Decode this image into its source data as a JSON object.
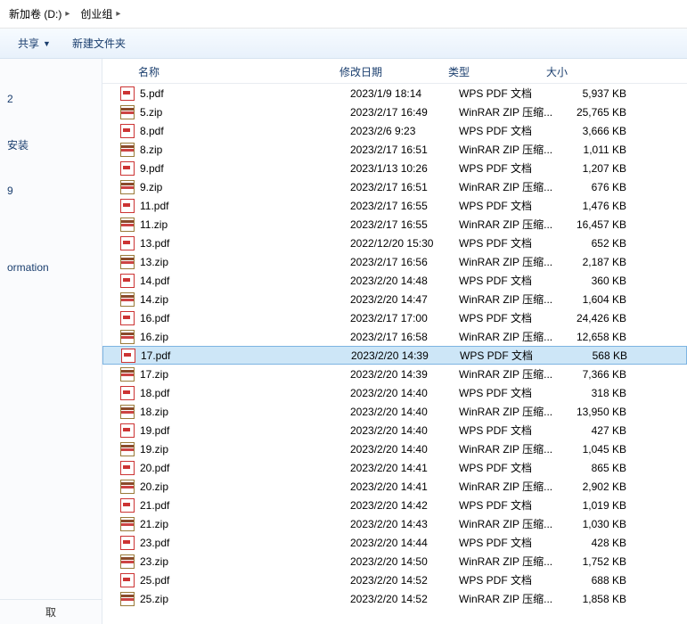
{
  "address": {
    "segments": [
      {
        "label": "新加卷 (D:)"
      },
      {
        "label": "创业组"
      }
    ]
  },
  "toolbar": {
    "share_label": "共享",
    "newfolder_label": "新建文件夹"
  },
  "navpane": {
    "items": [
      {
        "label": ""
      },
      {
        "label": ""
      },
      {
        "label": "2"
      },
      {
        "label": ""
      },
      {
        "label": ""
      },
      {
        "label": "安装"
      },
      {
        "label": ""
      },
      {
        "label": ""
      },
      {
        "label": "9"
      },
      {
        "label": ""
      },
      {
        "label": ""
      },
      {
        "label": ""
      },
      {
        "label": ""
      },
      {
        "label": ""
      },
      {
        "label": "ormation"
      },
      {
        "label": ""
      },
      {
        "label": ""
      },
      {
        "label": ""
      },
      {
        "label": ""
      }
    ],
    "bottom_label": "取"
  },
  "columns": {
    "name": "名称",
    "date": "修改日期",
    "type": "类型",
    "size": "大小"
  },
  "files": [
    {
      "name": "5.pdf",
      "icon": "pdf",
      "date": "2023/1/9 18:14",
      "type": "WPS PDF 文档",
      "size": "5,937 KB",
      "selected": false
    },
    {
      "name": "5.zip",
      "icon": "zip",
      "date": "2023/2/17 16:49",
      "type": "WinRAR ZIP 压缩...",
      "size": "25,765 KB",
      "selected": false
    },
    {
      "name": "8.pdf",
      "icon": "pdf",
      "date": "2023/2/6 9:23",
      "type": "WPS PDF 文档",
      "size": "3,666 KB",
      "selected": false
    },
    {
      "name": "8.zip",
      "icon": "zip",
      "date": "2023/2/17 16:51",
      "type": "WinRAR ZIP 压缩...",
      "size": "1,011 KB",
      "selected": false
    },
    {
      "name": "9.pdf",
      "icon": "pdf",
      "date": "2023/1/13 10:26",
      "type": "WPS PDF 文档",
      "size": "1,207 KB",
      "selected": false
    },
    {
      "name": "9.zip",
      "icon": "zip",
      "date": "2023/2/17 16:51",
      "type": "WinRAR ZIP 压缩...",
      "size": "676 KB",
      "selected": false
    },
    {
      "name": "11.pdf",
      "icon": "pdf",
      "date": "2023/2/17 16:55",
      "type": "WPS PDF 文档",
      "size": "1,476 KB",
      "selected": false
    },
    {
      "name": "11.zip",
      "icon": "zip",
      "date": "2023/2/17 16:55",
      "type": "WinRAR ZIP 压缩...",
      "size": "16,457 KB",
      "selected": false
    },
    {
      "name": "13.pdf",
      "icon": "pdf",
      "date": "2022/12/20 15:30",
      "type": "WPS PDF 文档",
      "size": "652 KB",
      "selected": false
    },
    {
      "name": "13.zip",
      "icon": "zip",
      "date": "2023/2/17 16:56",
      "type": "WinRAR ZIP 压缩...",
      "size": "2,187 KB",
      "selected": false
    },
    {
      "name": "14.pdf",
      "icon": "pdf",
      "date": "2023/2/20 14:48",
      "type": "WPS PDF 文档",
      "size": "360 KB",
      "selected": false
    },
    {
      "name": "14.zip",
      "icon": "zip",
      "date": "2023/2/20 14:47",
      "type": "WinRAR ZIP 压缩...",
      "size": "1,604 KB",
      "selected": false
    },
    {
      "name": "16.pdf",
      "icon": "pdf",
      "date": "2023/2/17 17:00",
      "type": "WPS PDF 文档",
      "size": "24,426 KB",
      "selected": false
    },
    {
      "name": "16.zip",
      "icon": "zip",
      "date": "2023/2/17 16:58",
      "type": "WinRAR ZIP 压缩...",
      "size": "12,658 KB",
      "selected": false
    },
    {
      "name": "17.pdf",
      "icon": "pdf",
      "date": "2023/2/20 14:39",
      "type": "WPS PDF 文档",
      "size": "568 KB",
      "selected": true
    },
    {
      "name": "17.zip",
      "icon": "zip",
      "date": "2023/2/20 14:39",
      "type": "WinRAR ZIP 压缩...",
      "size": "7,366 KB",
      "selected": false
    },
    {
      "name": "18.pdf",
      "icon": "pdf",
      "date": "2023/2/20 14:40",
      "type": "WPS PDF 文档",
      "size": "318 KB",
      "selected": false
    },
    {
      "name": "18.zip",
      "icon": "zip",
      "date": "2023/2/20 14:40",
      "type": "WinRAR ZIP 压缩...",
      "size": "13,950 KB",
      "selected": false
    },
    {
      "name": "19.pdf",
      "icon": "pdf",
      "date": "2023/2/20 14:40",
      "type": "WPS PDF 文档",
      "size": "427 KB",
      "selected": false
    },
    {
      "name": "19.zip",
      "icon": "zip",
      "date": "2023/2/20 14:40",
      "type": "WinRAR ZIP 压缩...",
      "size": "1,045 KB",
      "selected": false
    },
    {
      "name": "20.pdf",
      "icon": "pdf",
      "date": "2023/2/20 14:41",
      "type": "WPS PDF 文档",
      "size": "865 KB",
      "selected": false
    },
    {
      "name": "20.zip",
      "icon": "zip",
      "date": "2023/2/20 14:41",
      "type": "WinRAR ZIP 压缩...",
      "size": "2,902 KB",
      "selected": false
    },
    {
      "name": "21.pdf",
      "icon": "pdf",
      "date": "2023/2/20 14:42",
      "type": "WPS PDF 文档",
      "size": "1,019 KB",
      "selected": false
    },
    {
      "name": "21.zip",
      "icon": "zip",
      "date": "2023/2/20 14:43",
      "type": "WinRAR ZIP 压缩...",
      "size": "1,030 KB",
      "selected": false
    },
    {
      "name": "23.pdf",
      "icon": "pdf",
      "date": "2023/2/20 14:44",
      "type": "WPS PDF 文档",
      "size": "428 KB",
      "selected": false
    },
    {
      "name": "23.zip",
      "icon": "zip",
      "date": "2023/2/20 14:50",
      "type": "WinRAR ZIP 压缩...",
      "size": "1,752 KB",
      "selected": false
    },
    {
      "name": "25.pdf",
      "icon": "pdf",
      "date": "2023/2/20 14:52",
      "type": "WPS PDF 文档",
      "size": "688 KB",
      "selected": false
    },
    {
      "name": "25.zip",
      "icon": "zip",
      "date": "2023/2/20 14:52",
      "type": "WinRAR ZIP 压缩...",
      "size": "1,858 KB",
      "selected": false
    }
  ]
}
